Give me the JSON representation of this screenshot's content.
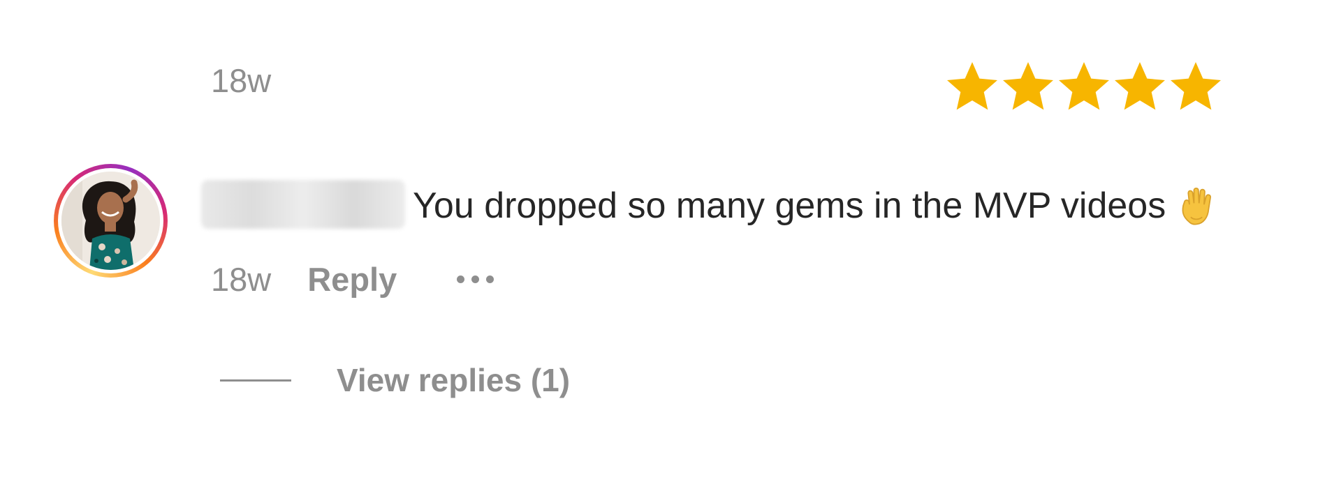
{
  "previous_comment": {
    "time": "18w"
  },
  "rating": {
    "stars": 5,
    "max": 5,
    "color": "#f7b500",
    "icon": "star-icon"
  },
  "comment": {
    "avatar": {
      "ring_colors": [
        "#feda75",
        "#fa7e1e",
        "#d62976",
        "#962fbf"
      ]
    },
    "text": "You dropped so many gems in the MVP videos",
    "emoji_icon": "raised-hand-icon",
    "time": "18w",
    "reply_label": "Reply",
    "more_icon": "more-options-icon"
  },
  "replies": {
    "label": "View replies (1)"
  },
  "colors": {
    "text": "#262626",
    "secondary": "#8e8e8e"
  }
}
